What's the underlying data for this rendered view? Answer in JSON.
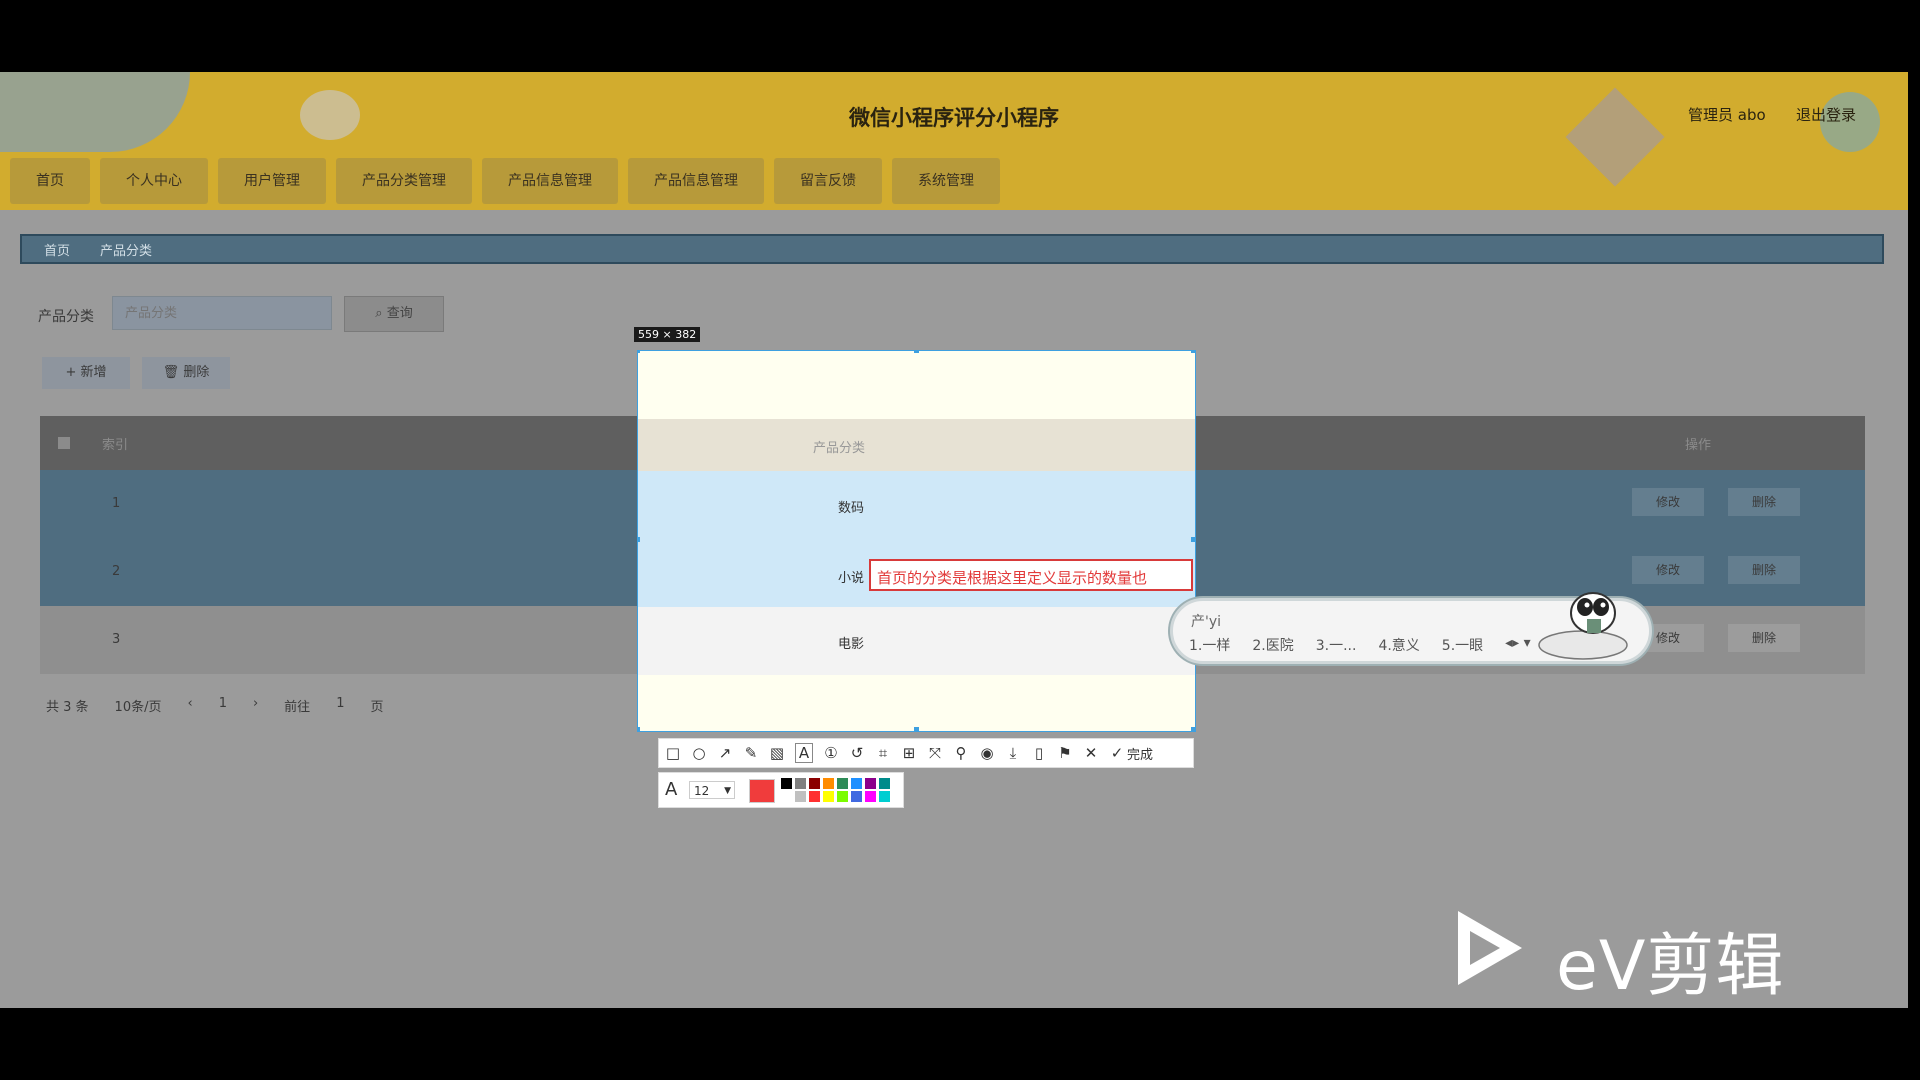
{
  "app": {
    "title": "微信小程序评分小程序",
    "admin": "管理员 abo",
    "logout": "退出登录"
  },
  "nav": [
    "首页",
    "个人中心",
    "用户管理",
    "产品分类管理",
    "产品信息管理",
    "产品信息管理",
    "留言反馈",
    "系统管理"
  ],
  "breadcrumb": [
    "首页",
    "产品分类"
  ],
  "filter": {
    "label": "产品分类",
    "placeholder": "产品分类",
    "query": "查询"
  },
  "actions": {
    "add": "新增",
    "delete": "删除"
  },
  "table": {
    "headers": [
      "索引",
      "产品分类",
      "操作"
    ],
    "rows": [
      {
        "index": "1",
        "category": "数码",
        "edit": "修改",
        "del": "删除"
      },
      {
        "index": "2",
        "category": "小说",
        "edit": "修改",
        "del": "删除"
      },
      {
        "index": "3",
        "category": "电影",
        "edit": "修改",
        "del": "删除"
      }
    ]
  },
  "pager": {
    "total": "共 3 条",
    "per_page": "10条/页",
    "page": "1",
    "goto": "前往",
    "goto_page": "1",
    "page_unit": "页"
  },
  "screenshot": {
    "size_label": "559 × 382",
    "annotation_text": "首页的分类是根据这里定义显示的数量也",
    "done_label": "完成",
    "font_size": "12",
    "current_color": "#f03c3c",
    "palette": [
      "#000000",
      "#808080",
      "#8b0000",
      "#ff8c00",
      "#2e8b57",
      "#1e90ff",
      "#8b008b",
      "#008b8b",
      "#ffffff",
      "#c0c0c0",
      "#ff3030",
      "#ffff00",
      "#7cfc00",
      "#4169e1",
      "#ff00ff",
      "#00ced1"
    ]
  },
  "ime": {
    "input": "产'yi",
    "candidates": [
      "1.一样",
      "2.医院",
      "3.一...",
      "4.意义",
      "5.一眼"
    ]
  },
  "watermark": "eV剪辑"
}
